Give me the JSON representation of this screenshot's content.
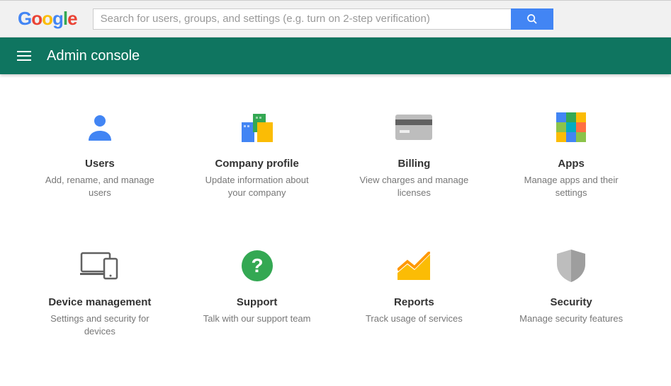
{
  "search": {
    "placeholder": "Search for users, groups, and settings (e.g. turn on 2-step verification)"
  },
  "nav": {
    "title": "Admin console"
  },
  "cards": [
    {
      "title": "Users",
      "desc": "Add, rename, and manage users"
    },
    {
      "title": "Company profile",
      "desc": "Update information about your company"
    },
    {
      "title": "Billing",
      "desc": "View charges and manage licenses"
    },
    {
      "title": "Apps",
      "desc": "Manage apps and their settings"
    },
    {
      "title": "Device management",
      "desc": "Settings and security for devices"
    },
    {
      "title": "Support",
      "desc": "Talk with our support team"
    },
    {
      "title": "Reports",
      "desc": "Track usage of services"
    },
    {
      "title": "Security",
      "desc": "Manage security features"
    }
  ]
}
